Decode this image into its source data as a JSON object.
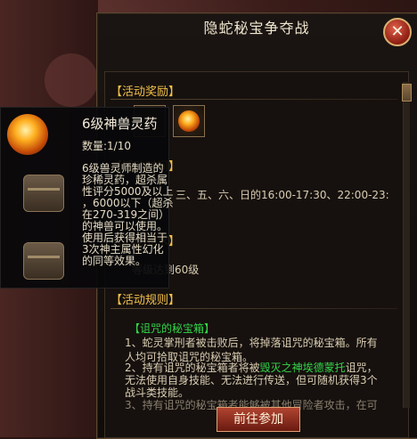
{
  "window": {
    "title": "隐蛇秘宝争夺战",
    "close_icon": "close-icon"
  },
  "sections": {
    "rewards": "【活动奖励】",
    "time": "【活动时间】",
    "requirements": "【活动要求】",
    "rules": "【活动规则】"
  },
  "time_text": "三、五、六、日的16:00-17:30、22:00-23:",
  "requirement_text": "等级达到60级",
  "tooltip": {
    "name": "6级神兽灵药",
    "count": "数量:1/10",
    "desc": [
      "6级兽灵师制造的",
      "珍稀灵药，超杀属",
      "性评分5000及以上",
      "，6000以下（超杀",
      "在270-319之间）",
      "的神兽可以使用。",
      "使用后获得相当于",
      "3次神主属性幻化",
      "的同等效果。"
    ]
  },
  "rules": {
    "title": "【诅咒的秘宝箱】",
    "line1": "1、蛇灵掌刑者被击败后，将掉落诅咒的秘宝箱。所有",
    "line2": "人均可拾取诅咒的秘宝箱。",
    "line3_pre": "2、持有诅咒的秘宝箱者将被",
    "line3_green": "毁灭之神埃德蒙托",
    "line3_post": "诅咒，",
    "line4": "无法使用自身技能、无法进行传送，但可随机获得3个",
    "line5": "战斗类技能。",
    "line6": "3、持有诅咒的秘宝箱者能够被其他冒险者攻击，在可"
  },
  "buttons": {
    "go": "前往参加"
  },
  "colors": {
    "accent": "#f2c04a",
    "highlight": "#33d64a",
    "button": "#b04430"
  }
}
